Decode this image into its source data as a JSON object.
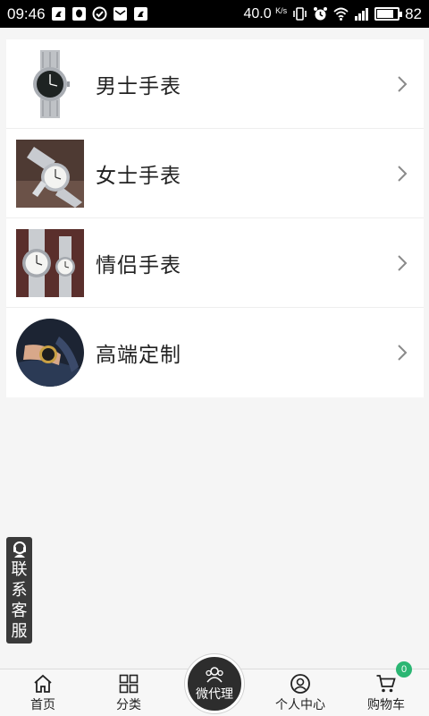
{
  "status_bar": {
    "time": "09:46",
    "net_speed_value": "40.0",
    "net_speed_unit": "K/s",
    "battery_level": "82",
    "battery_fraction": 0.82
  },
  "categories": [
    {
      "label": "男士手表",
      "thumb": "mens-watch-image"
    },
    {
      "label": "女士手表",
      "thumb": "womens-watch-image"
    },
    {
      "label": "情侣手表",
      "thumb": "couple-watch-image"
    },
    {
      "label": "高端定制",
      "thumb": "custom-watch-image"
    }
  ],
  "service": {
    "label": "联系客服",
    "icon": "headset-icon"
  },
  "tabs": {
    "home": {
      "label": "首页",
      "icon": "home-icon"
    },
    "category": {
      "label": "分类",
      "icon": "grid-icon"
    },
    "agent": {
      "label": "微代理",
      "icon": "users-icon"
    },
    "profile": {
      "label": "个人中心",
      "icon": "user-circle-icon"
    },
    "cart": {
      "label": "购物车",
      "icon": "cart-icon",
      "badge": "0"
    }
  },
  "colors": {
    "background": "#f5f5f5",
    "tab_bar": "#f7f7f7",
    "center_tab": "#2d2d2d",
    "badge": "#2bb673",
    "service_tab": "#3a3a3a"
  }
}
